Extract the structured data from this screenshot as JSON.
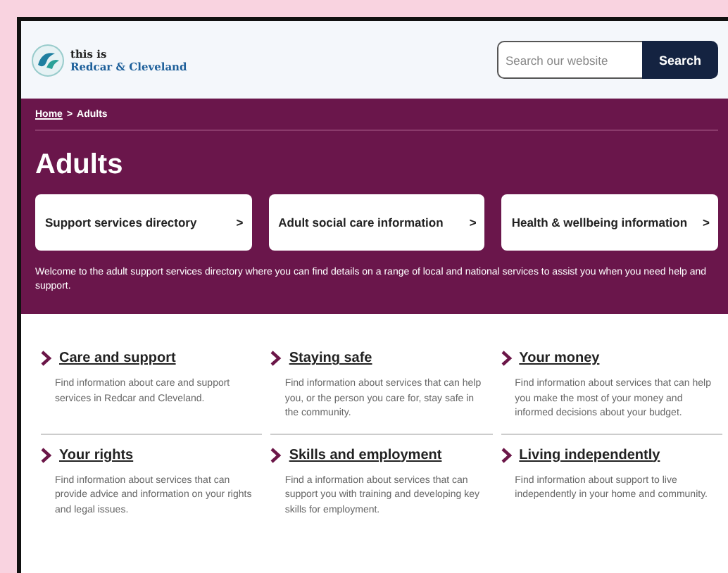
{
  "header": {
    "logo_line_1": "this is",
    "logo_line_2": "Redcar & Cleveland",
    "search": {
      "placeholder": "Search our website",
      "button": "Search"
    }
  },
  "breadcrumb": [
    {
      "label": "Home",
      "link": true
    },
    {
      "label": ">",
      "link": false
    },
    {
      "label": "Adults",
      "link": false
    }
  ],
  "title": "Adults",
  "cards": [
    {
      "label": "Support services directory",
      "arrow": ">"
    },
    {
      "label": "Adult social care information",
      "arrow": ">"
    },
    {
      "label": "Health & wellbeing information",
      "arrow": ">"
    }
  ],
  "intro": "Welcome to the adult support services directory where you can find details on a range of local and national services to assist you when you need help and support.",
  "topics": [
    {
      "title": "Care and support",
      "description": "Find information about care and support services in Redcar and Cleveland."
    },
    {
      "title": "Staying safe",
      "description": "Find information about services that can help you, or the person you care for, stay safe in the community."
    },
    {
      "title": "Your money",
      "description": "Find information about services that can help you make the most of your money and informed decisions about your budget."
    },
    {
      "title": "Your rights",
      "description": "Find information about services that can provide advice and information on your rights and legal issues."
    },
    {
      "title": "Skills and employment",
      "description": "Find a information about services that can support you with training and developing key skills for employment."
    },
    {
      "title": "Living independently",
      "description": "Find information about support to live independently in your home and community."
    }
  ]
}
